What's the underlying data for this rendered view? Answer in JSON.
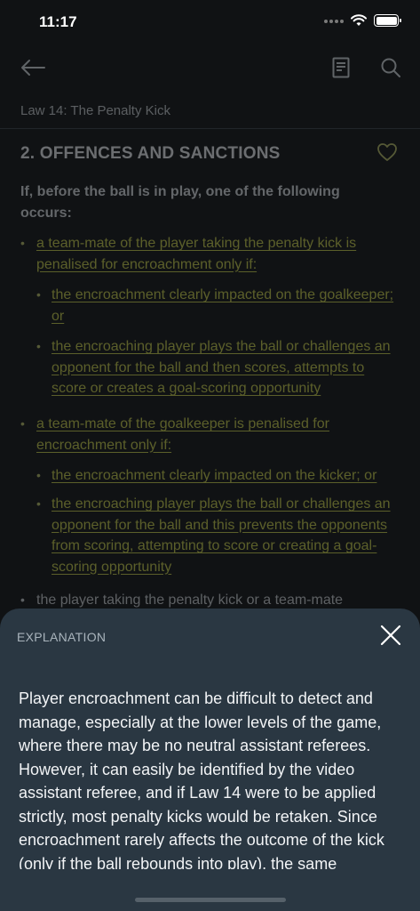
{
  "status_bar": {
    "time": "11:17"
  },
  "header": {
    "breadcrumb": "Law 14: The Penalty Kick"
  },
  "section": {
    "title": "2. OFFENCES AND SANCTIONS",
    "intro": "If, before the ball is in play, one of the following occurs:"
  },
  "items": [
    {
      "text": "a team-mate of the player taking the penalty kick is penalised for encroachment only if:",
      "subitems": [
        {
          "text": "the encroachment clearly impacted on the goalkeeper; or"
        },
        {
          "text": "the encroaching player plays the ball or challenges an opponent for the ball and then scores, attempts to score or creates a goal-scoring opportunity"
        }
      ]
    },
    {
      "text": "a team-mate of the goalkeeper is penalised for encroachment only if:",
      "subitems": [
        {
          "text": "the encroachment clearly impacted on the kicker; or"
        },
        {
          "text": "the encroaching player plays the ball or challenges an opponent for the ball and this prevents the opponents from scoring, attempting to score or creating a goal-scoring opportunity"
        }
      ]
    },
    {
      "text": "the player taking the penalty kick or a team-mate"
    }
  ],
  "explanation": {
    "label": "EXPLANATION",
    "body": "Player encroachment can be difficult to detect and manage, especially at the lower levels of the game, where there may be no neutral assistant referees. However, it can easily be identified by the video assistant referee, and if Law 14 were to be applied strictly, most penalty kicks would be retaken. Since encroachment rarely affects the outcome of the kick (only if the ball rebounds into play), the same"
  },
  "icons": {
    "back": "arrow-left-icon",
    "notes": "notes-icon",
    "search": "search-icon",
    "favorite": "heart-icon",
    "close": "close-icon"
  },
  "colors": {
    "background": "#101214",
    "link": "#c4c94a",
    "sheet": "#2a3742",
    "heart_outline": "#b5bb66"
  }
}
